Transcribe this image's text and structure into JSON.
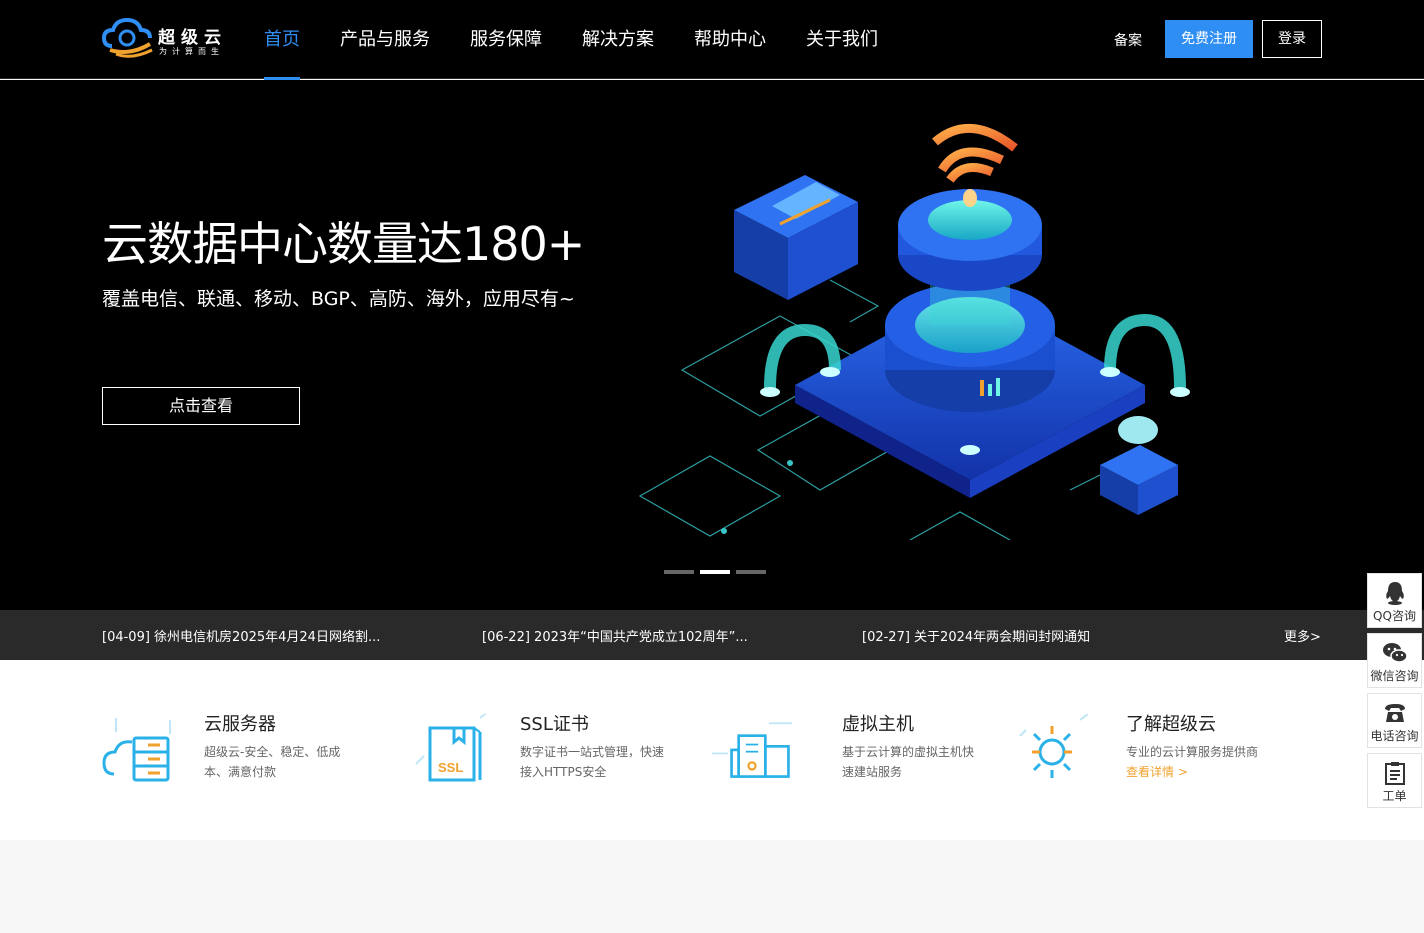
{
  "brand": {
    "name": "超级云",
    "slogan": "为计算而生"
  },
  "nav": {
    "items": [
      "首页",
      "产品与服务",
      "服务保障",
      "解决方案",
      "帮助中心",
      "关于我们"
    ],
    "active": 0
  },
  "header": {
    "beian": "备案",
    "register": "免费注册",
    "login": "登录"
  },
  "hero": {
    "title": "云数据中心数量达180+",
    "subtitle": "覆盖电信、联通、移动、BGP、高防、海外，应用尽有~",
    "button": "点击查看",
    "slides": 3,
    "active_slide": 1
  },
  "news": {
    "items": [
      "[04-09] 徐州电信机房2025年4月24日网络割...",
      "[06-22] 2023年“中国共产党成立102周年”...",
      "[02-27] 关于2024年两会期间封网通知"
    ],
    "more": "更多>"
  },
  "features": [
    {
      "title": "云服务器",
      "desc": "超级云-安全、稳定、低成本、满意付款",
      "icon": "cloud-server-icon"
    },
    {
      "title": "SSL证书",
      "desc": "数字证书一站式管理，快速接入HTTPS安全",
      "icon": "ssl-certificate-icon"
    },
    {
      "title": "虚拟主机",
      "desc": "基于云计算的虚拟主机快速建站服务",
      "icon": "virtual-host-icon"
    },
    {
      "title": "了解超级云",
      "desc": "专业的云计算服务提供商",
      "link": "查看详情 >",
      "icon": "sun-icon"
    }
  ],
  "sidebar": {
    "qq": "QQ咨询",
    "wechat": "微信咨询",
    "phone": "电话咨询",
    "ticket": "工单"
  },
  "colors": {
    "accent": "#2f8ef4",
    "link": "#f0a22e",
    "header_bg": "#000000",
    "news_bg": "#2a2a2a"
  }
}
